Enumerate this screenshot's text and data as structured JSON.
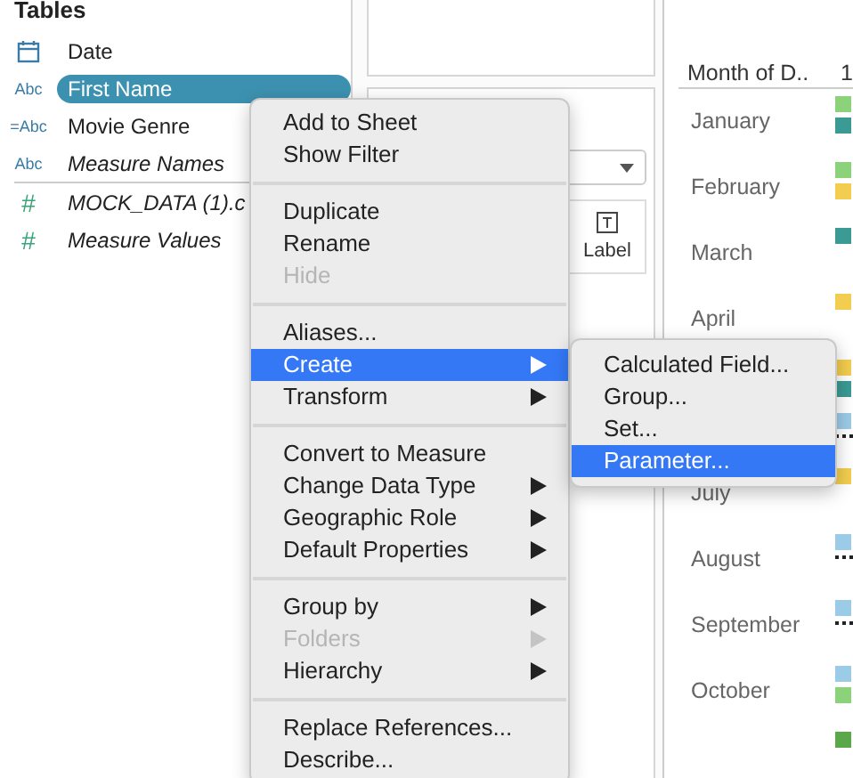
{
  "data_pane": {
    "title": "Tables",
    "groups": [
      [
        {
          "kind": "date",
          "name": "Date",
          "italic": false,
          "selected": false
        },
        {
          "kind": "string",
          "icon": "Abc",
          "name": "First Name",
          "italic": false,
          "selected": true
        },
        {
          "kind": "string",
          "icon": "=Abc",
          "name": "Movie Genre",
          "italic": false,
          "selected": false
        },
        {
          "kind": "string",
          "icon": "Abc",
          "name": "Measure Names",
          "italic": true,
          "selected": false
        }
      ],
      [
        {
          "kind": "number",
          "icon": "#",
          "name": "MOCK_DATA (1).c",
          "italic": true,
          "selected": false
        },
        {
          "kind": "number",
          "icon": "#",
          "name": "Measure Values",
          "italic": true,
          "selected": false
        }
      ]
    ]
  },
  "marks_card": {
    "label_button": "Label"
  },
  "view": {
    "header": "Month of D..",
    "column_2_header": "1",
    "rows": [
      {
        "label": "January",
        "marks": [
          {
            "kind": "square",
            "color": "#8bd27a"
          },
          {
            "kind": "square",
            "color": "#3b9a94"
          }
        ]
      },
      {
        "label": "February",
        "marks": [
          {
            "kind": "square",
            "color": "#8bd27a"
          },
          {
            "kind": "square",
            "color": "#f2cd4f"
          }
        ]
      },
      {
        "label": "March",
        "marks": [
          {
            "kind": "square",
            "color": "#3b9a94"
          }
        ]
      },
      {
        "label": "April",
        "marks": [
          {
            "kind": "square",
            "color": "#f2cd4f"
          }
        ]
      },
      {
        "marks": [
          {
            "kind": "square",
            "color": "#f2cd4f"
          },
          {
            "kind": "square",
            "color": "#3b9a94"
          }
        ]
      },
      {
        "marks": [
          {
            "kind": "square",
            "color": "#9ccbe8"
          },
          {
            "kind": "more"
          }
        ]
      },
      {
        "label": "July",
        "marks": [
          {
            "kind": "square",
            "color": "#f2cd4f"
          }
        ]
      },
      {
        "label": "August",
        "marks": [
          {
            "kind": "square",
            "color": "#9ccbe8"
          },
          {
            "kind": "more"
          }
        ]
      },
      {
        "label": "September",
        "marks": [
          {
            "kind": "square",
            "color": "#9ccbe8"
          },
          {
            "kind": "more"
          }
        ]
      },
      {
        "label": "October",
        "marks": [
          {
            "kind": "square",
            "color": "#9ccbe8"
          },
          {
            "kind": "square",
            "color": "#8bd27a"
          }
        ]
      },
      {
        "marks": [
          {
            "kind": "square",
            "color": "#5aa84a"
          }
        ]
      }
    ]
  },
  "context_menu": {
    "groups": [
      [
        {
          "label": "Add to Sheet",
          "submenu": false,
          "disabled": false,
          "selected": false
        },
        {
          "label": "Show Filter",
          "submenu": false,
          "disabled": false,
          "selected": false
        }
      ],
      [
        {
          "label": "Duplicate",
          "submenu": false,
          "disabled": false,
          "selected": false
        },
        {
          "label": "Rename",
          "submenu": false,
          "disabled": false,
          "selected": false
        },
        {
          "label": "Hide",
          "submenu": false,
          "disabled": true,
          "selected": false
        }
      ],
      [
        {
          "label": "Aliases...",
          "submenu": false,
          "disabled": false,
          "selected": false
        },
        {
          "label": "Create",
          "submenu": true,
          "disabled": false,
          "selected": true
        },
        {
          "label": "Transform",
          "submenu": true,
          "disabled": false,
          "selected": false
        }
      ],
      [
        {
          "label": "Convert to Measure",
          "submenu": false,
          "disabled": false,
          "selected": false
        },
        {
          "label": "Change Data Type",
          "submenu": true,
          "disabled": false,
          "selected": false
        },
        {
          "label": "Geographic Role",
          "submenu": true,
          "disabled": false,
          "selected": false
        },
        {
          "label": "Default Properties",
          "submenu": true,
          "disabled": false,
          "selected": false
        }
      ],
      [
        {
          "label": "Group by",
          "submenu": true,
          "disabled": false,
          "selected": false
        },
        {
          "label": "Folders",
          "submenu": true,
          "disabled": true,
          "selected": false
        },
        {
          "label": "Hierarchy",
          "submenu": true,
          "disabled": false,
          "selected": false
        }
      ],
      [
        {
          "label": "Replace References...",
          "submenu": false,
          "disabled": false,
          "selected": false
        },
        {
          "label": "Describe...",
          "submenu": false,
          "disabled": false,
          "selected": false
        }
      ]
    ]
  },
  "submenu": {
    "items": [
      {
        "label": "Calculated Field...",
        "selected": false
      },
      {
        "label": "Group...",
        "selected": false
      },
      {
        "label": "Set...",
        "selected": false
      },
      {
        "label": "Parameter...",
        "selected": true
      }
    ]
  }
}
